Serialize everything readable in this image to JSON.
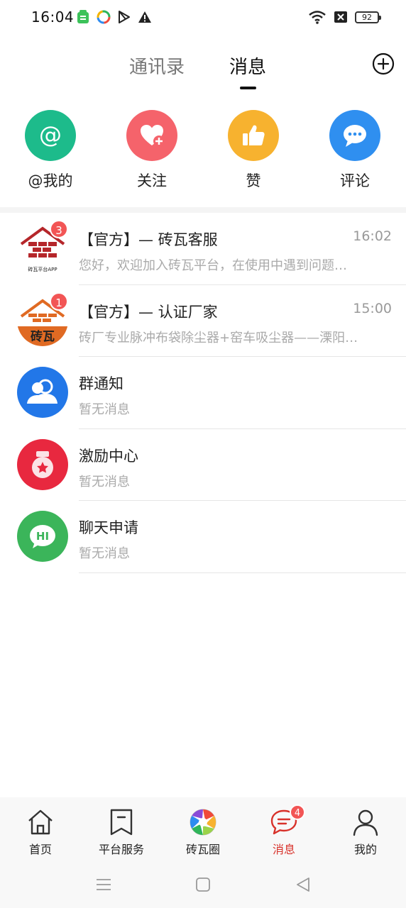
{
  "status_bar": {
    "time": "16:04",
    "battery": "92",
    "icons": [
      "app-store-icon",
      "colorful-app-icon",
      "play-store-icon",
      "warning-icon",
      "wifi-icon",
      "sim-off-icon",
      "battery-icon"
    ]
  },
  "header": {
    "tab_contacts": "通讯录",
    "tab_messages": "消息",
    "active_tab": "消息",
    "add_icon": "plus-circle-icon"
  },
  "quick_actions": [
    {
      "label": "@我的",
      "icon": "at-icon",
      "color": "#1dbb8b"
    },
    {
      "label": "关注",
      "icon": "heart-plus-icon",
      "color": "#f5636b"
    },
    {
      "label": "赞",
      "icon": "thumbs-up-icon",
      "color": "#f7b22f"
    },
    {
      "label": "评论",
      "icon": "chat-bubble-icon",
      "color": "#2f8ff0"
    }
  ],
  "messages": [
    {
      "title": "【官方】— 砖瓦客服",
      "time": "16:02",
      "preview": "您好，欢迎加入砖瓦平台，在使用中遇到问题…",
      "badge": "3",
      "avatar_text": "砖瓦平台APP"
    },
    {
      "title": "【官方】— 认证厂家",
      "time": "15:00",
      "preview": "砖厂专业脉冲布袋除尘器+窑车吸尘器——溧阳…",
      "badge": "1",
      "avatar_text": "砖瓦"
    },
    {
      "title": "群通知",
      "time": "",
      "preview": "暂无消息",
      "icon": "group-icon",
      "color": "#2277e8"
    },
    {
      "title": "激励中心",
      "time": "",
      "preview": "暂无消息",
      "icon": "medal-icon",
      "color": "#e8283f"
    },
    {
      "title": "聊天申请",
      "time": "",
      "preview": "暂无消息",
      "icon": "hi-bubble-icon",
      "color": "#3bb55a",
      "icon_text": "HI"
    }
  ],
  "bottom_nav": [
    {
      "label": "首页",
      "icon": "home-icon"
    },
    {
      "label": "平台服务",
      "icon": "bookmark-icon"
    },
    {
      "label": "砖瓦圈",
      "icon": "aperture-icon"
    },
    {
      "label": "消息",
      "icon": "message-icon",
      "badge": "4",
      "active": true
    },
    {
      "label": "我的",
      "icon": "user-icon"
    }
  ],
  "colors": {
    "accent_red": "#d8322b",
    "badge_red": "#f25555"
  }
}
